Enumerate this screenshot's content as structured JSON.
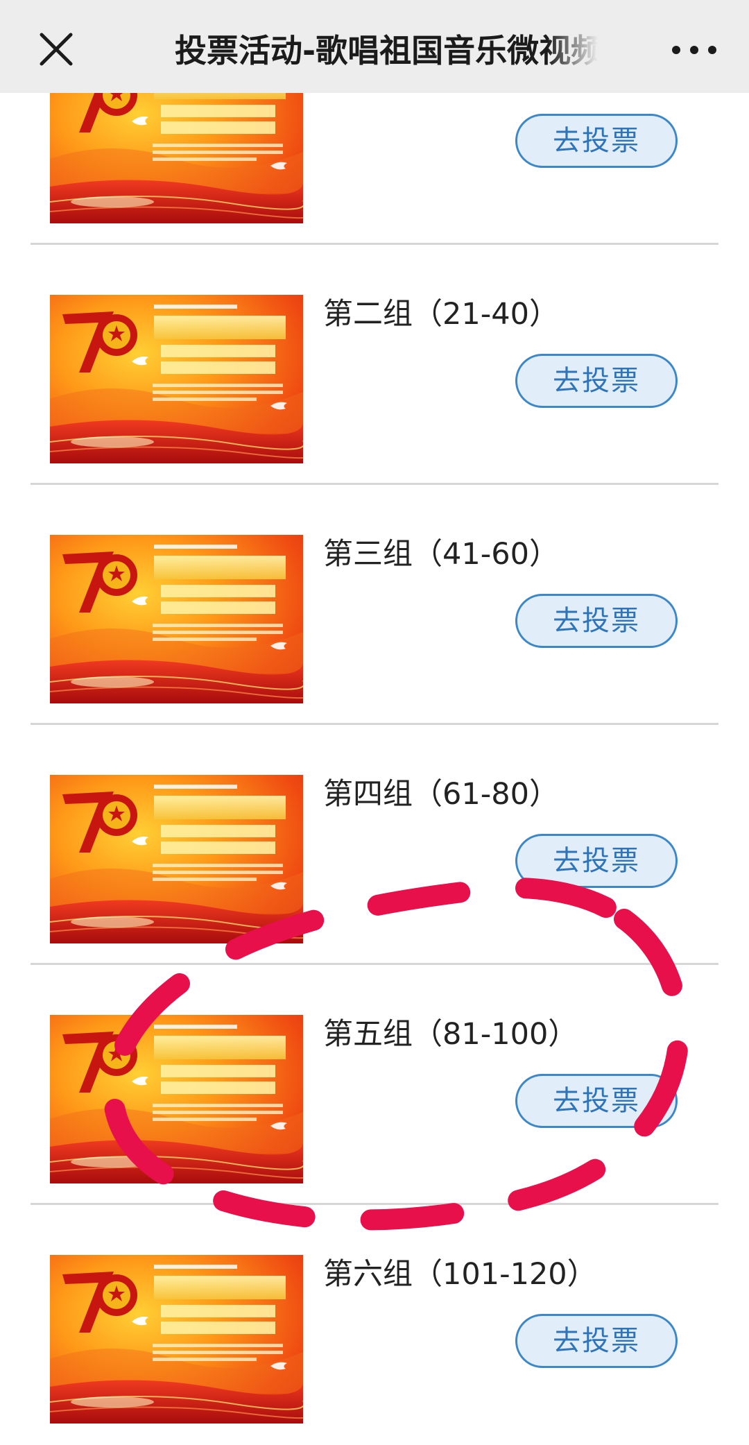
{
  "header": {
    "title": "投票活动-歌唱祖国音乐微视频展播暨评选活动"
  },
  "banner": {
    "tagline": "唱经典歌曲  庆七十华诞",
    "big_title": "歌唱祖国",
    "subtitle_1": "网络音乐微视频",
    "subtitle_2": "展播暨评选活动",
    "credit_1": "主办单位：中共江苏省委网信办   江苏省国资委",
    "credit_2": "共青团江苏省委   新华报业传媒集团",
    "credit_3": "承办单位：交汇点云媒科技股份有限公司",
    "badge": "70"
  },
  "groups": [
    {
      "label": "",
      "button": "去投票"
    },
    {
      "label": "第二组（21-40）",
      "button": "去投票"
    },
    {
      "label": "第三组（41-60）",
      "button": "去投票"
    },
    {
      "label": "第四组（61-80）",
      "button": "去投票"
    },
    {
      "label": "第五组（81-100）",
      "button": "去投票"
    },
    {
      "label": "第六组（101-120）",
      "button": "去投票"
    }
  ],
  "colors": {
    "accent": "#3d87c6",
    "button_bg": "#e1eefa",
    "marker": "#e8104a"
  },
  "icons": {
    "close": "close-icon",
    "more": "more-icon"
  }
}
